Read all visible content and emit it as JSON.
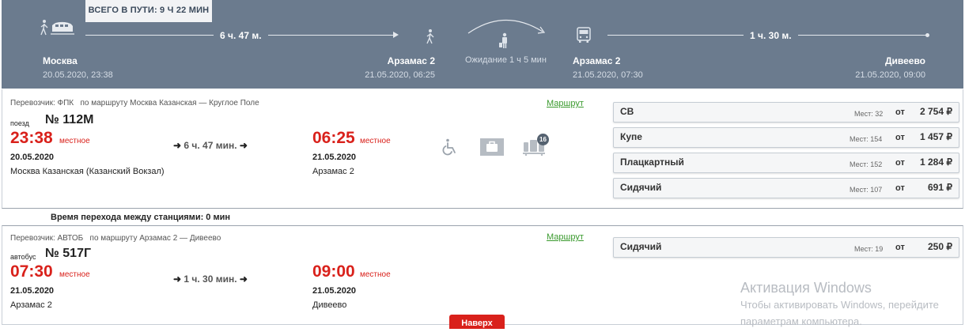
{
  "header": {
    "total_label": "ВСЕГО В ПУТИ: 9 Ч 22 МИН",
    "seg1_duration": "6 ч. 47 м.",
    "seg2_duration": "1 ч. 30 м.",
    "wait_text": "Ожидание 1 ч 5 мин",
    "stops": [
      {
        "city": "Москва",
        "datetime": "20.05.2020, 23:38"
      },
      {
        "city": "Арзамас 2",
        "datetime": "21.05.2020, 06:25"
      },
      {
        "city": "Арзамас 2",
        "datetime": "21.05.2020, 07:30"
      },
      {
        "city": "Дивеево",
        "datetime": "21.05.2020, 09:00"
      }
    ]
  },
  "segments": [
    {
      "carrier": "Перевозчик: ФПК",
      "route": "по маршруту Москва Казанская — Круглое Поле",
      "route_link": "Маршрут",
      "type": "поезд",
      "number": "№ 112М",
      "dep_time": "23:38",
      "arr_time": "06:25",
      "local_label": "местное",
      "duration": "6 ч. 47 мин.",
      "dep_date": "20.05.2020",
      "arr_date": "21.05.2020",
      "dep_station": "Москва Казанская (Казанский Вокзал)",
      "arr_station": "Арзамас 2",
      "luggage_badge": "16",
      "seats": [
        {
          "class": "СВ",
          "places": "Мест: 32",
          "from": "от",
          "price": "2 754 ₽"
        },
        {
          "class": "Купе",
          "places": "Мест: 154",
          "from": "от",
          "price": "1 457 ₽"
        },
        {
          "class": "Плацкартный",
          "places": "Мест: 152",
          "from": "от",
          "price": "1 284 ₽"
        },
        {
          "class": "Сидячий",
          "places": "Мест: 107",
          "from": "от",
          "price": "691 ₽"
        }
      ]
    },
    {
      "carrier": "Перевозчик: АВТОБ",
      "route": "по маршруту Арзамас 2 — Дивеево",
      "route_link": "Маршрут",
      "type": "автобус",
      "number": "№ 517Г",
      "dep_time": "07:30",
      "arr_time": "09:00",
      "local_label": "местное",
      "duration": "1 ч. 30 мин.",
      "dep_date": "21.05.2020",
      "arr_date": "21.05.2020",
      "dep_station": "Арзамас 2",
      "arr_station": "Дивеево",
      "seats": [
        {
          "class": "Сидячий",
          "places": "Мест: 19",
          "from": "от",
          "price": "250 ₽"
        }
      ]
    }
  ],
  "transfer_text": "Время перехода между станциями: 0 мин",
  "up_button": "Наверх",
  "watermark": {
    "title": "Активация Windows",
    "line1": "Чтобы активировать Windows, перейдите",
    "line2": "параметрам компьютера."
  },
  "colors": {
    "header_bg": "#6b7b8e",
    "accent_red": "#d9211b",
    "link_green": "#3a9a2e"
  }
}
